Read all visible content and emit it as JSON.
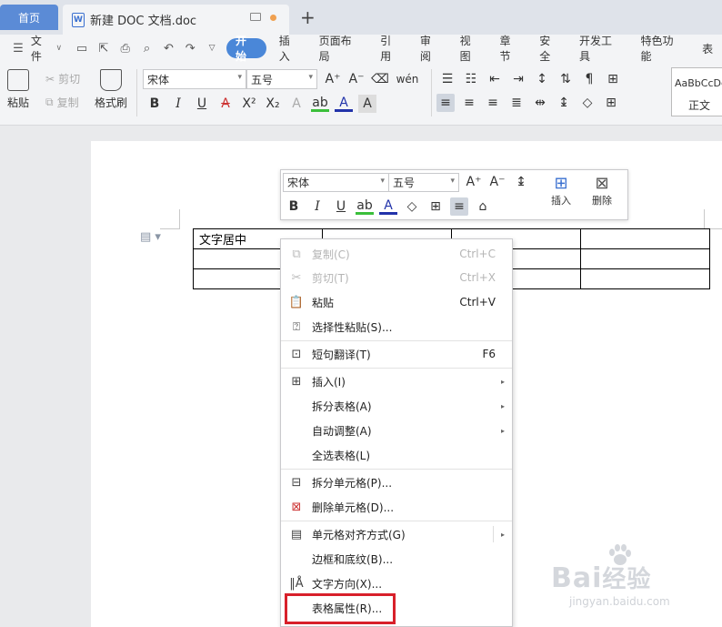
{
  "tabs": {
    "home": "首页",
    "document": "新建 DOC 文档.doc",
    "doc_icon": "W",
    "new_tab": "+"
  },
  "menu": {
    "file": "文件",
    "items": [
      "开始",
      "插入",
      "页面布局",
      "引用",
      "审阅",
      "视图",
      "章节",
      "安全",
      "开发工具",
      "特色功能",
      "表"
    ],
    "active_index": 0
  },
  "ribbon": {
    "paste": "粘贴",
    "cut": "剪切",
    "copy": "复制",
    "format_painter": "格式刷",
    "font": "宋体",
    "size": "五号",
    "style_sample": "AaBbCcDd",
    "style_name": "正文"
  },
  "mini_toolbar": {
    "font": "宋体",
    "size": "五号",
    "insert": "插入",
    "delete": "删除"
  },
  "table": {
    "rows": [
      [
        "文字居中",
        "",
        "",
        ""
      ],
      [
        "",
        "",
        "",
        ""
      ],
      [
        "",
        "",
        "",
        ""
      ]
    ]
  },
  "context_menu": {
    "items": [
      {
        "label": "复制(C)",
        "shortcut": "Ctrl+C",
        "disabled": true
      },
      {
        "label": "剪切(T)",
        "shortcut": "Ctrl+X",
        "disabled": true
      },
      {
        "label": "粘贴",
        "shortcut": "Ctrl+V",
        "disabled": false
      },
      {
        "label": "选择性粘贴(S)...",
        "shortcut": "",
        "disabled": false
      },
      {
        "label": "短句翻译(T)",
        "shortcut": "F6",
        "disabled": false
      },
      {
        "label": "插入(I)",
        "shortcut": "",
        "disabled": false
      },
      {
        "label": "拆分表格(A)",
        "shortcut": "",
        "disabled": false
      },
      {
        "label": "自动调整(A)",
        "shortcut": "",
        "disabled": false
      },
      {
        "label": "全选表格(L)",
        "shortcut": "",
        "disabled": false
      },
      {
        "label": "拆分单元格(P)...",
        "shortcut": "",
        "disabled": false
      },
      {
        "label": "删除单元格(D)...",
        "shortcut": "",
        "disabled": false
      },
      {
        "label": "单元格对齐方式(G)",
        "shortcut": "",
        "disabled": false
      },
      {
        "label": "边框和底纹(B)...",
        "shortcut": "",
        "disabled": false
      },
      {
        "label": "文字方向(X)...",
        "shortcut": "",
        "disabled": false
      },
      {
        "label": "表格属性(R)...",
        "shortcut": "",
        "disabled": false
      }
    ],
    "highlight_color": "#d8202a"
  },
  "watermark": {
    "brand": "Bai",
    "brand_suffix": "经验",
    "url": "jingyan.baidu.com"
  },
  "colors": {
    "accent": "#4a87d8",
    "home_tab": "#5b8bd6"
  }
}
